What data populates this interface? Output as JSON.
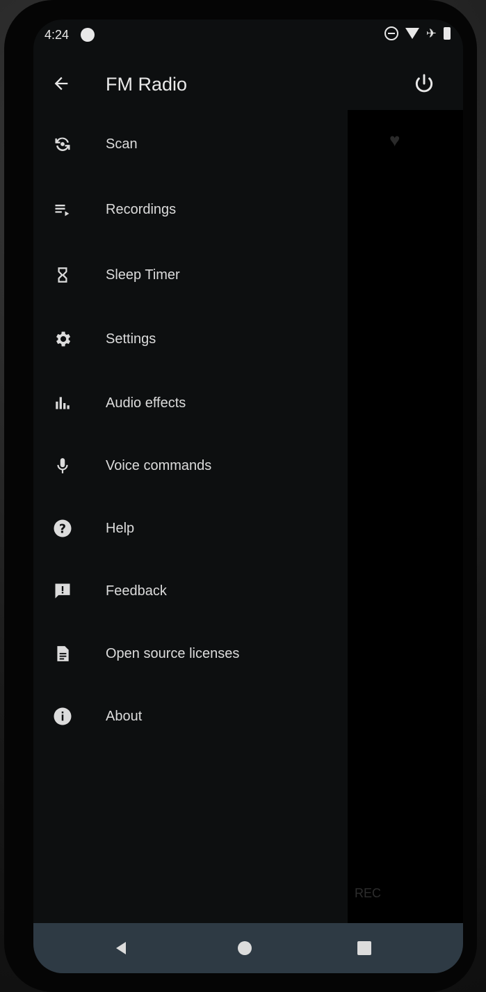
{
  "status_bar": {
    "time": "4:24",
    "icons": [
      "do-not-disturb-icon",
      "wifi-icon",
      "airplane-icon",
      "battery-icon"
    ]
  },
  "app_bar": {
    "title": "FM Radio",
    "back_icon": "arrow-left-icon",
    "power_icon": "power-icon"
  },
  "menu": {
    "items": [
      {
        "label": "Scan",
        "icon": "scan-icon"
      },
      {
        "label": "Recordings",
        "icon": "playlist-play-icon"
      },
      {
        "label": "Sleep Timer",
        "icon": "hourglass-icon"
      },
      {
        "label": "Settings",
        "icon": "gear-icon"
      },
      {
        "label": "Audio effects",
        "icon": "equalizer-icon"
      },
      {
        "label": "Voice commands",
        "icon": "microphone-icon"
      },
      {
        "label": "Help",
        "icon": "help-circle-icon"
      },
      {
        "label": "Feedback",
        "icon": "feedback-icon"
      },
      {
        "label": "Open source licenses",
        "icon": "document-icon"
      },
      {
        "label": "About",
        "icon": "info-icon"
      }
    ]
  },
  "background": {
    "rec_label": "REC"
  },
  "nav_bar": {
    "back": "nav-back-icon",
    "home": "nav-home-icon",
    "recents": "nav-recents-icon"
  },
  "colors": {
    "screen_bg": "#0d0f10",
    "text": "#dcdcdc",
    "navbar_bg": "#2e3a44"
  }
}
